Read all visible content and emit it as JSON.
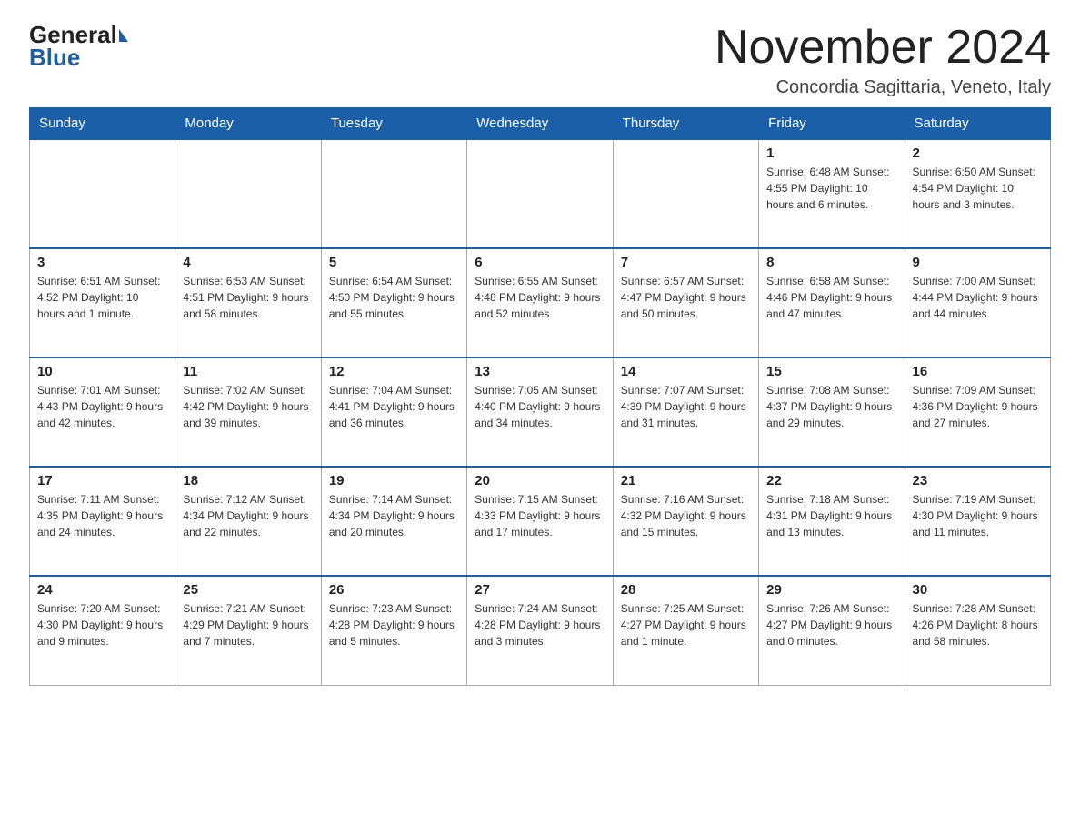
{
  "logo": {
    "general": "General",
    "triangle": "",
    "blue": "Blue"
  },
  "title": "November 2024",
  "location": "Concordia Sagittaria, Veneto, Italy",
  "days_of_week": [
    "Sunday",
    "Monday",
    "Tuesday",
    "Wednesday",
    "Thursday",
    "Friday",
    "Saturday"
  ],
  "weeks": [
    [
      {
        "day": "",
        "info": ""
      },
      {
        "day": "",
        "info": ""
      },
      {
        "day": "",
        "info": ""
      },
      {
        "day": "",
        "info": ""
      },
      {
        "day": "",
        "info": ""
      },
      {
        "day": "1",
        "info": "Sunrise: 6:48 AM\nSunset: 4:55 PM\nDaylight: 10 hours and 6 minutes."
      },
      {
        "day": "2",
        "info": "Sunrise: 6:50 AM\nSunset: 4:54 PM\nDaylight: 10 hours and 3 minutes."
      }
    ],
    [
      {
        "day": "3",
        "info": "Sunrise: 6:51 AM\nSunset: 4:52 PM\nDaylight: 10 hours and 1 minute."
      },
      {
        "day": "4",
        "info": "Sunrise: 6:53 AM\nSunset: 4:51 PM\nDaylight: 9 hours and 58 minutes."
      },
      {
        "day": "5",
        "info": "Sunrise: 6:54 AM\nSunset: 4:50 PM\nDaylight: 9 hours and 55 minutes."
      },
      {
        "day": "6",
        "info": "Sunrise: 6:55 AM\nSunset: 4:48 PM\nDaylight: 9 hours and 52 minutes."
      },
      {
        "day": "7",
        "info": "Sunrise: 6:57 AM\nSunset: 4:47 PM\nDaylight: 9 hours and 50 minutes."
      },
      {
        "day": "8",
        "info": "Sunrise: 6:58 AM\nSunset: 4:46 PM\nDaylight: 9 hours and 47 minutes."
      },
      {
        "day": "9",
        "info": "Sunrise: 7:00 AM\nSunset: 4:44 PM\nDaylight: 9 hours and 44 minutes."
      }
    ],
    [
      {
        "day": "10",
        "info": "Sunrise: 7:01 AM\nSunset: 4:43 PM\nDaylight: 9 hours and 42 minutes."
      },
      {
        "day": "11",
        "info": "Sunrise: 7:02 AM\nSunset: 4:42 PM\nDaylight: 9 hours and 39 minutes."
      },
      {
        "day": "12",
        "info": "Sunrise: 7:04 AM\nSunset: 4:41 PM\nDaylight: 9 hours and 36 minutes."
      },
      {
        "day": "13",
        "info": "Sunrise: 7:05 AM\nSunset: 4:40 PM\nDaylight: 9 hours and 34 minutes."
      },
      {
        "day": "14",
        "info": "Sunrise: 7:07 AM\nSunset: 4:39 PM\nDaylight: 9 hours and 31 minutes."
      },
      {
        "day": "15",
        "info": "Sunrise: 7:08 AM\nSunset: 4:37 PM\nDaylight: 9 hours and 29 minutes."
      },
      {
        "day": "16",
        "info": "Sunrise: 7:09 AM\nSunset: 4:36 PM\nDaylight: 9 hours and 27 minutes."
      }
    ],
    [
      {
        "day": "17",
        "info": "Sunrise: 7:11 AM\nSunset: 4:35 PM\nDaylight: 9 hours and 24 minutes."
      },
      {
        "day": "18",
        "info": "Sunrise: 7:12 AM\nSunset: 4:34 PM\nDaylight: 9 hours and 22 minutes."
      },
      {
        "day": "19",
        "info": "Sunrise: 7:14 AM\nSunset: 4:34 PM\nDaylight: 9 hours and 20 minutes."
      },
      {
        "day": "20",
        "info": "Sunrise: 7:15 AM\nSunset: 4:33 PM\nDaylight: 9 hours and 17 minutes."
      },
      {
        "day": "21",
        "info": "Sunrise: 7:16 AM\nSunset: 4:32 PM\nDaylight: 9 hours and 15 minutes."
      },
      {
        "day": "22",
        "info": "Sunrise: 7:18 AM\nSunset: 4:31 PM\nDaylight: 9 hours and 13 minutes."
      },
      {
        "day": "23",
        "info": "Sunrise: 7:19 AM\nSunset: 4:30 PM\nDaylight: 9 hours and 11 minutes."
      }
    ],
    [
      {
        "day": "24",
        "info": "Sunrise: 7:20 AM\nSunset: 4:30 PM\nDaylight: 9 hours and 9 minutes."
      },
      {
        "day": "25",
        "info": "Sunrise: 7:21 AM\nSunset: 4:29 PM\nDaylight: 9 hours and 7 minutes."
      },
      {
        "day": "26",
        "info": "Sunrise: 7:23 AM\nSunset: 4:28 PM\nDaylight: 9 hours and 5 minutes."
      },
      {
        "day": "27",
        "info": "Sunrise: 7:24 AM\nSunset: 4:28 PM\nDaylight: 9 hours and 3 minutes."
      },
      {
        "day": "28",
        "info": "Sunrise: 7:25 AM\nSunset: 4:27 PM\nDaylight: 9 hours and 1 minute."
      },
      {
        "day": "29",
        "info": "Sunrise: 7:26 AM\nSunset: 4:27 PM\nDaylight: 9 hours and 0 minutes."
      },
      {
        "day": "30",
        "info": "Sunrise: 7:28 AM\nSunset: 4:26 PM\nDaylight: 8 hours and 58 minutes."
      }
    ]
  ]
}
